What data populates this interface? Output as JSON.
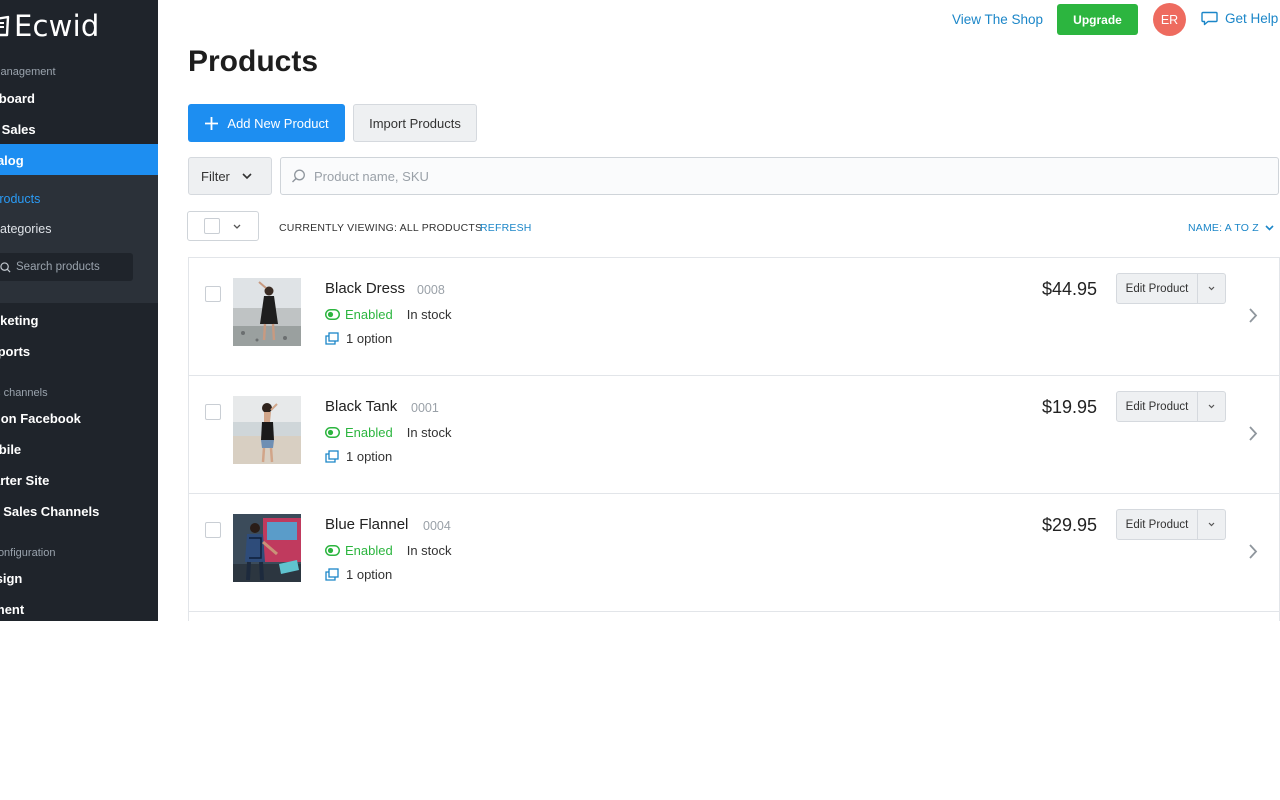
{
  "app": {
    "brand": "Ecwid"
  },
  "sidebar": {
    "sections": [
      {
        "label": "Store management"
      },
      {
        "label": "Sales channels"
      },
      {
        "label": "Configuration"
      }
    ],
    "items": [
      {
        "label": "Dashboard"
      },
      {
        "label": "My Sales"
      },
      {
        "label": "Catalog"
      },
      {
        "label": "Marketing"
      },
      {
        "label": "Reports"
      },
      {
        "label": "Sell on Facebook"
      },
      {
        "label": "Mobile"
      },
      {
        "label": "Starter Site"
      },
      {
        "label": "All Sales Channels"
      },
      {
        "label": "Design"
      },
      {
        "label": "Payment"
      }
    ],
    "catalog_sub": [
      {
        "label": "Products"
      },
      {
        "label": "Categories"
      }
    ],
    "search_placeholder": "Search products"
  },
  "topbar": {
    "view_shop": "View The Shop",
    "upgrade": "Upgrade",
    "avatar_initials": "ER",
    "get_help": "Get Help"
  },
  "page": {
    "title": "Products",
    "add_product": "Add New Product",
    "import_products": "Import Products",
    "filter_label": "Filter",
    "search_placeholder": "Product name, SKU",
    "viewing_label": "CURRENTLY VIEWING: ALL PRODUCTS",
    "refresh_label": "REFRESH",
    "sort_label": "NAME: A TO Z"
  },
  "products": [
    {
      "name": "Black Dress",
      "sku": "0008",
      "status": "Enabled",
      "stock": "In stock",
      "options": "1 option",
      "price": "$44.95",
      "edit": "Edit Product"
    },
    {
      "name": "Black Tank",
      "sku": "0001",
      "status": "Enabled",
      "stock": "In stock",
      "options": "1 option",
      "price": "$19.95",
      "edit": "Edit Product"
    },
    {
      "name": "Blue Flannel",
      "sku": "0004",
      "status": "Enabled",
      "stock": "In stock",
      "options": "1 option",
      "price": "$29.95",
      "edit": "Edit Product"
    }
  ],
  "colors": {
    "sidebar_bg": "#1f242b",
    "accent_blue": "#1d8ef1",
    "link_blue": "#1b86c8",
    "success_green": "#2cb53f",
    "avatar_red": "#ee6b5f"
  }
}
